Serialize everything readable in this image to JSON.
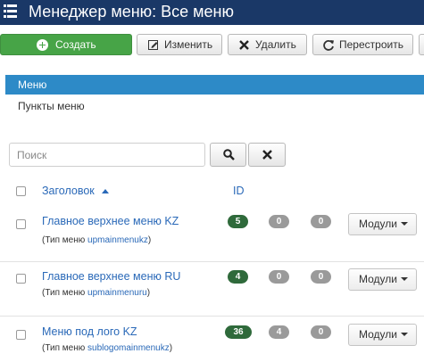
{
  "header": {
    "title": "Менеджер меню: Все меню"
  },
  "toolbar": {
    "create": "Создать",
    "edit": "Изменить",
    "delete": "Удалить",
    "rebuild": "Перестроить"
  },
  "subnav": {
    "active": "Меню",
    "item": "Пункты меню"
  },
  "search": {
    "placeholder": "Поиск"
  },
  "table": {
    "col_title": "Заголовок",
    "col_id": "ID",
    "rows": [
      {
        "title": "Главное верхнее меню KZ",
        "type_prefix": "(Тип меню ",
        "type_value": "upmainmenukz",
        "type_suffix": ")",
        "published": "5",
        "unpublished": "0",
        "trashed": "0",
        "modules_label": "Модули"
      },
      {
        "title": "Главное верхнее меню RU",
        "type_prefix": "(Тип меню ",
        "type_value": "upmainmenuru",
        "type_suffix": ")",
        "published": "4",
        "unpublished": "0",
        "trashed": "0",
        "modules_label": "Модули"
      },
      {
        "title": "Меню под лого KZ",
        "type_prefix": "(Тип меню ",
        "type_value": "sublogomainmenukz",
        "type_suffix": ")",
        "published": "36",
        "unpublished": "4",
        "trashed": "0",
        "modules_label": "Модули"
      }
    ]
  },
  "colors": {
    "header_bg": "#1a3867",
    "create_green": "#47a447",
    "nav_active": "#2d8ac7",
    "link": "#2a69b8",
    "badge_green": "#2f6a3b",
    "badge_gray": "#9a9a9a"
  }
}
